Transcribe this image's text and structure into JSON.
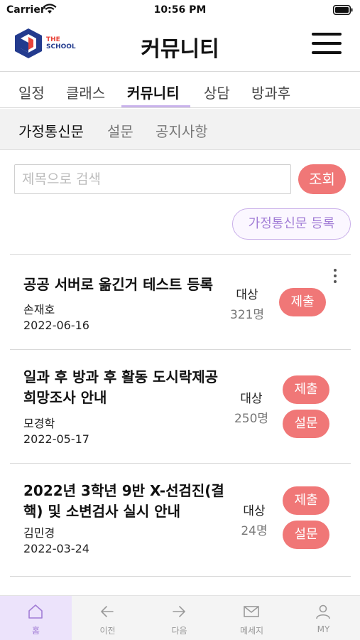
{
  "status_bar": {
    "carrier": "Carrier",
    "time": "10:56 PM"
  },
  "header": {
    "logo_line1": "THE",
    "logo_line2": "SCHOOL",
    "title": "커뮤니티",
    "menu_icon": "hamburger-menu-icon"
  },
  "main_tabs": [
    {
      "label": "일정",
      "active": false
    },
    {
      "label": "클래스",
      "active": false
    },
    {
      "label": "커뮤니티",
      "active": true
    },
    {
      "label": "상담",
      "active": false
    },
    {
      "label": "방과후",
      "active": false
    }
  ],
  "sub_tabs": [
    {
      "label": "가정통신문",
      "active": true
    },
    {
      "label": "설문",
      "active": false
    },
    {
      "label": "공지사항",
      "active": false
    }
  ],
  "search": {
    "placeholder": "제목으로 검색",
    "value": "",
    "button_label": "조회"
  },
  "register_button_label": "가정통신문 등록",
  "notices": [
    {
      "title_lines": [
        "공공 서버로 옮긴거 테스트 등록"
      ],
      "author": "손재호",
      "date": "2022-06-16",
      "target_label": "대상",
      "target_count": "321명",
      "buttons": [
        "제출"
      ],
      "has_more_menu": true
    },
    {
      "title_lines": [
        "일과 후 방과 후 활동 도시락제공",
        "희망조사 안내"
      ],
      "author": "모경학",
      "date": "2022-05-17",
      "target_label": "대상",
      "target_count": "250명",
      "buttons": [
        "제출",
        "설문"
      ],
      "has_more_menu": false
    },
    {
      "title_lines": [
        "2022년 3학년 9반 X-선검진(결",
        "핵) 및 소변검사 실시 안내"
      ],
      "author": "김민경",
      "date": "2022-03-24",
      "target_label": "대상",
      "target_count": "24명",
      "buttons": [
        "제출",
        "설문"
      ],
      "has_more_menu": false
    }
  ],
  "bottom_nav": [
    {
      "label": "홈",
      "icon": "home-icon",
      "active": true
    },
    {
      "label": "이전",
      "icon": "arrow-left-icon",
      "active": false
    },
    {
      "label": "다음",
      "icon": "arrow-right-icon",
      "active": false
    },
    {
      "label": "메세지",
      "icon": "envelope-icon",
      "active": false
    },
    {
      "label": "MY",
      "icon": "person-icon",
      "active": false
    }
  ],
  "colors": {
    "accent_button": "#f07777",
    "tab_underline": "#c9b3ec",
    "register_border": "#c8aee9",
    "register_text": "#a27dd6",
    "nav_active_bg": "#ece3fb"
  }
}
